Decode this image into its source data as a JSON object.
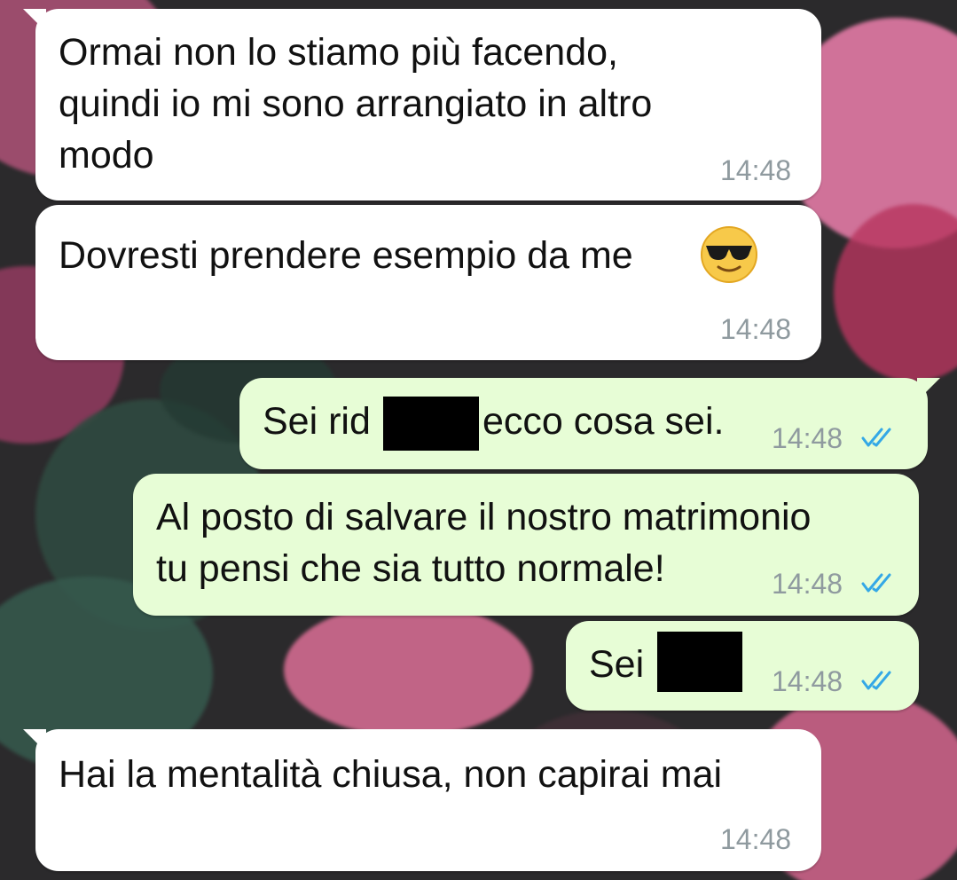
{
  "colors": {
    "incoming_bubble": "#ffffff",
    "outgoing_bubble": "#e7fdd6",
    "timestamp": "#8f9a9f",
    "read_ticks": "#34a8e6",
    "redaction": "#000000"
  },
  "messages": [
    {
      "direction": "incoming",
      "text": "Ormai non lo stiamo più facendo,\nquindi io mi sono arrangiato in altro\nmodo",
      "time": "14:48"
    },
    {
      "direction": "incoming",
      "text": "Dovresti prendere esempio da me",
      "emoji": "smiling-face-with-sunglasses",
      "time": "14:48"
    },
    {
      "direction": "outgoing",
      "text_before_redaction": "Sei rid",
      "text_after_redaction": "ecco cosa sei.",
      "time": "14:48",
      "status_icon": "double-check-read"
    },
    {
      "direction": "outgoing",
      "text": "Al posto di salvare il nostro matrimonio\ntu pensi che sia tutto normale!",
      "time": "14:48",
      "status_icon": "double-check-read"
    },
    {
      "direction": "outgoing",
      "text_before_redaction": "Sei",
      "time": "14:48",
      "status_icon": "double-check-read"
    },
    {
      "direction": "incoming",
      "text": "Hai la mentalità chiusa, non capirai mai",
      "time": "14:48"
    }
  ]
}
